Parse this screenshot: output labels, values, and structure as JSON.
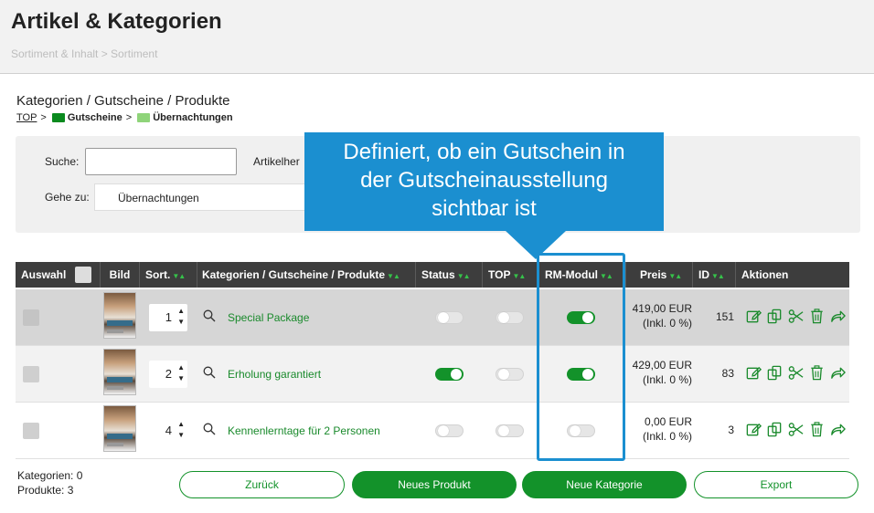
{
  "page": {
    "title": "Artikel & Kategorien",
    "breadcrumb": "Sortiment & Inhalt > Sortiment"
  },
  "section": {
    "title": "Kategorien / Gutscheine / Produkte",
    "path": {
      "top": "TOP",
      "sep1": ">",
      "folder1": "Gutscheine",
      "sep2": ">",
      "folder2": "Übernachtungen"
    }
  },
  "filters": {
    "search_label": "Suche:",
    "search_value": "",
    "manufacturer_label": "Artikelher",
    "goto_label": "Gehe zu:",
    "goto_value": "Übernachtungen"
  },
  "callout": {
    "text_line1": "Definiert, ob ein Gutschein in",
    "text_line2": "der Gutscheinausstellung",
    "text_line3": "sichtbar ist"
  },
  "table": {
    "headers": {
      "select": "Auswahl",
      "image": "Bild",
      "sort": "Sort.",
      "name": "Kategorien / Gutscheine / Produkte",
      "status": "Status",
      "top": "TOP",
      "rm_module": "RM-Modul",
      "price": "Preis",
      "id": "ID",
      "actions": "Aktionen"
    },
    "rows": [
      {
        "sort": "1",
        "name": "Special Package",
        "status": false,
        "top": false,
        "rm_module": true,
        "price": "419,00 EUR",
        "price_note": "(Inkl. 0 %)",
        "id": "151"
      },
      {
        "sort": "2",
        "name": "Erholung garantiert",
        "status": true,
        "top": false,
        "rm_module": true,
        "price": "429,00 EUR",
        "price_note": "(Inkl. 0 %)",
        "id": "83"
      },
      {
        "sort": "4",
        "name": "Kennenlerntage für 2 Personen",
        "status": false,
        "top": false,
        "rm_module": false,
        "price": "0,00 EUR",
        "price_note": "(Inkl. 0 %)",
        "id": "3"
      }
    ]
  },
  "footer": {
    "categories": "Kategorien: 0",
    "products": "Produkte: 3",
    "back_button": "Zurück",
    "new_product_button": "Neues Produkt",
    "new_category_button": "Neue Kategorie",
    "export_button": "Export"
  },
  "colors": {
    "accent_green": "#13922a",
    "callout_blue": "#1b8fd0",
    "header_dark": "#3d3d3d"
  }
}
